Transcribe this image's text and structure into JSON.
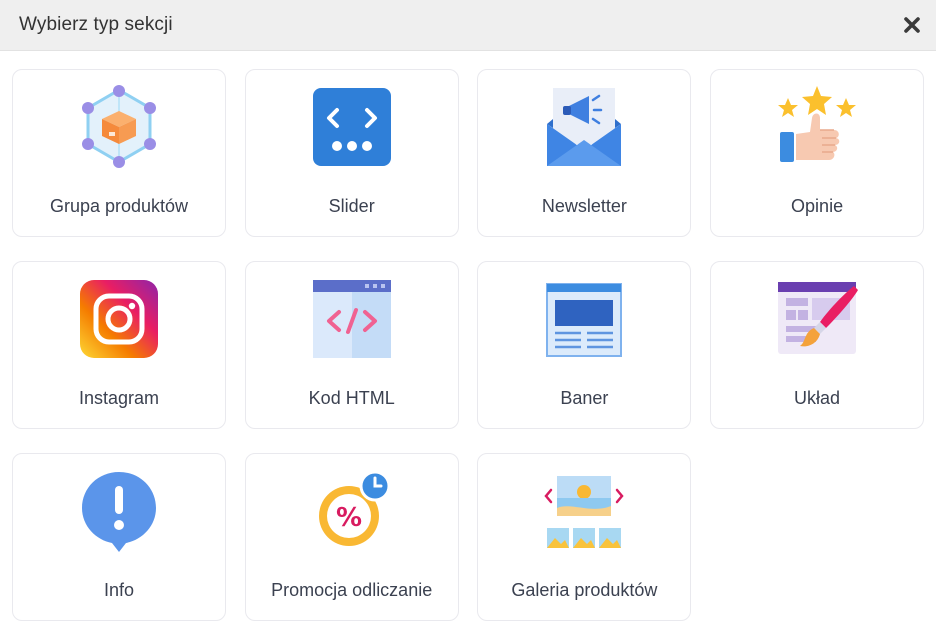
{
  "dialog": {
    "title": "Wybierz typ sekcji",
    "close_icon": "close-icon"
  },
  "tiles": [
    {
      "label": "Grupa produktów",
      "icon": "product-group-icon"
    },
    {
      "label": "Slider",
      "icon": "slider-icon"
    },
    {
      "label": "Newsletter",
      "icon": "newsletter-icon"
    },
    {
      "label": "Opinie",
      "icon": "reviews-icon"
    },
    {
      "label": "Instagram",
      "icon": "instagram-icon"
    },
    {
      "label": "Kod HTML",
      "icon": "html-code-icon"
    },
    {
      "label": "Baner",
      "icon": "banner-icon"
    },
    {
      "label": "Układ",
      "icon": "layout-icon"
    },
    {
      "label": "Info",
      "icon": "info-icon"
    },
    {
      "label": "Promocja odliczanie",
      "icon": "countdown-promo-icon"
    },
    {
      "label": "Galeria produktów",
      "icon": "product-gallery-icon"
    }
  ],
  "colors": {
    "header_bg": "#efefef",
    "tile_border": "#e9e9ee",
    "accent_blue": "#3c8ce0"
  }
}
